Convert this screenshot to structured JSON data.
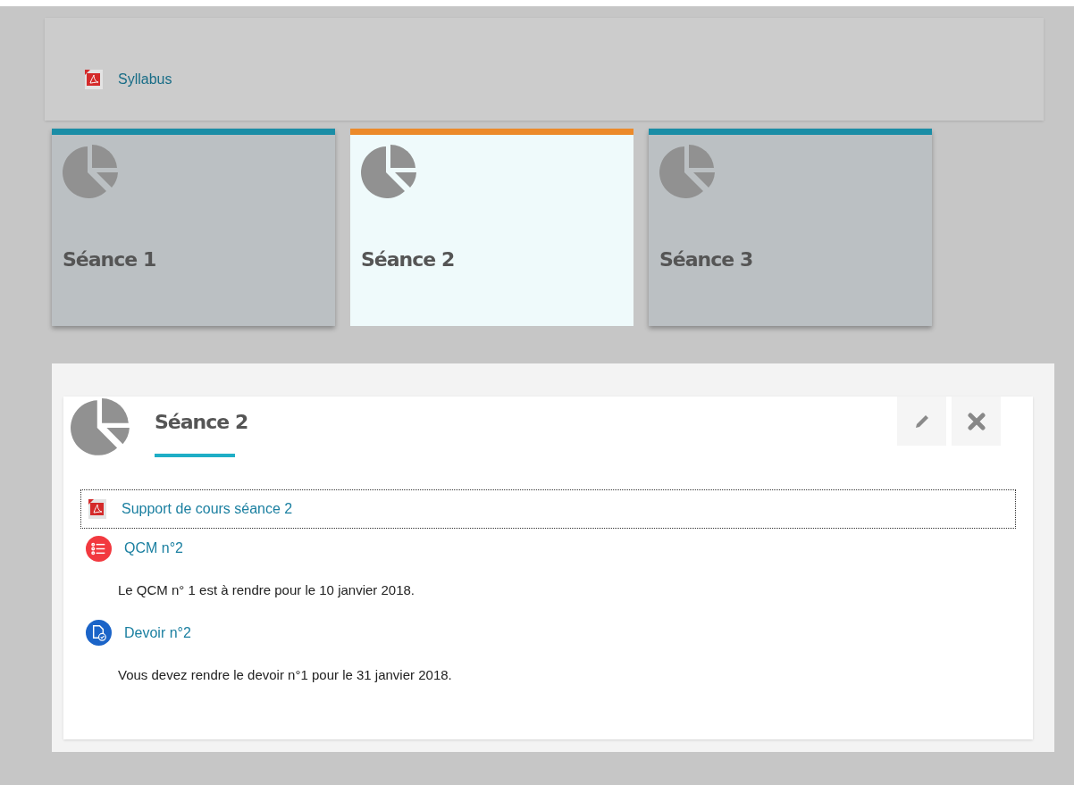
{
  "header": {
    "link": "Syllabus"
  },
  "sessions": [
    {
      "title": "Séance 1",
      "selected": false,
      "color": "#1a8da6"
    },
    {
      "title": "Séance 2",
      "selected": true,
      "color": "#ec8a2a"
    },
    {
      "title": "Séance 3",
      "selected": false,
      "color": "#1a8da6"
    }
  ],
  "detail": {
    "title": "Séance 2",
    "items": [
      {
        "kind": "pdf",
        "label": "Support de cours séance 2",
        "focused": true
      },
      {
        "kind": "quiz",
        "label": "QCM n°2",
        "focused": false,
        "description": "Le QCM n° 1 est à rendre pour le 10 janvier 2018."
      },
      {
        "kind": "assignment",
        "label": "Devoir n°2",
        "focused": false,
        "description": "Vous devez rendre le devoir n°1 pour le 31 janvier 2018."
      }
    ]
  }
}
